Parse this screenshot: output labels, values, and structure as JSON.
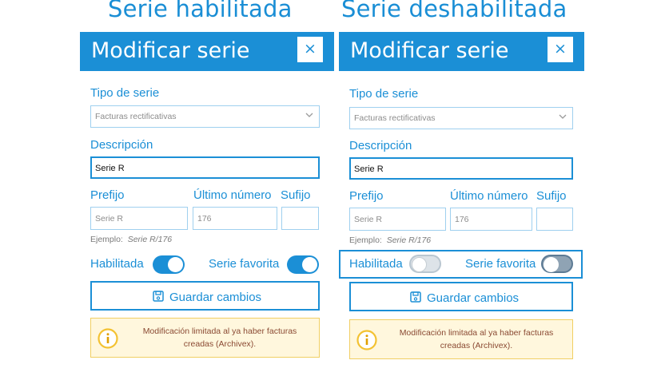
{
  "headings": {
    "enabled": "Serie habilitada",
    "disabled": "Serie deshabilitada"
  },
  "dialog": {
    "title": "Modificar serie",
    "close_glyph": "×",
    "tipo_label": "Tipo de serie",
    "tipo_value": "Facturas rectificativas",
    "descripcion_label": "Descripción",
    "descripcion_value": "Serie R",
    "prefijo_label": "Prefijo",
    "ultimo_label": "Último número",
    "sufijo_label": "Sufijo",
    "prefijo_value": "Serie R",
    "ultimo_value": "176",
    "sufijo_value": "",
    "example_prefix": "Ejemplo:",
    "example_value": "Serie R/176",
    "habilitada_label": "Habilitada",
    "favorita_label": "Serie favorita",
    "save_label": "Guardar cambios",
    "alert_text": "Modificación limitada al ya haber facturas creadas (Archivex)."
  },
  "panels": {
    "enabled": {
      "habilitada_on": true,
      "favorita_on": true
    },
    "disabled": {
      "habilitada_on": false,
      "favorita_on": false
    }
  },
  "colors": {
    "accent": "#1b8fd6",
    "alert_bg": "#fff7dd",
    "alert_border": "#f1cf63",
    "alert_text": "#8a4a33"
  },
  "icons": {
    "close": "close-icon",
    "dropdown": "chevron-down-icon",
    "save": "save-icon",
    "info": "info-icon"
  }
}
